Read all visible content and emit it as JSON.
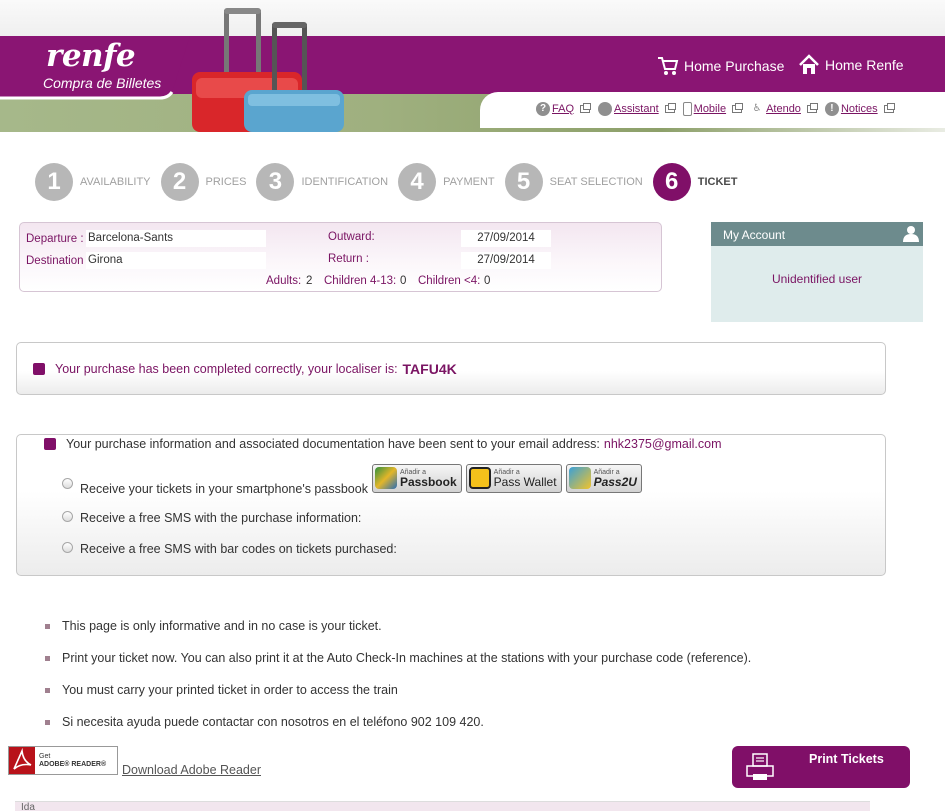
{
  "brand": {
    "logo": "renfe",
    "subtitle": "Compra de Billetes",
    "colors": {
      "primary": "#800f68",
      "account_header": "#6d8b8d",
      "account_bg": "#dfecec"
    }
  },
  "topnav": {
    "home_purchase": "Home Purchase",
    "home_renfe": "Home Renfe"
  },
  "utility": [
    {
      "icon": "help-icon",
      "label": "FAQ"
    },
    {
      "icon": "chat-icon",
      "label": "Assistant"
    },
    {
      "icon": "mobile-icon",
      "label": "Mobile"
    },
    {
      "icon": "accessibility-icon",
      "label": "Atendo"
    },
    {
      "icon": "alert-icon",
      "label": "Notices"
    }
  ],
  "steps": [
    {
      "num": "1",
      "label": "AVAILABILITY",
      "active": false
    },
    {
      "num": "2",
      "label": "PRICES",
      "active": false
    },
    {
      "num": "3",
      "label": "IDENTIFICATION",
      "active": false
    },
    {
      "num": "4",
      "label": "PAYMENT",
      "active": false
    },
    {
      "num": "5",
      "label": "SEAT SELECTION",
      "active": false
    },
    {
      "num": "6",
      "label": "TICKET",
      "active": true
    }
  ],
  "journey": {
    "departure_label": "Departure :",
    "departure": "Barcelona-Sants",
    "destination_label": "Destination",
    "destination": "Girona",
    "outward_label": "Outward:",
    "outward": "27/09/2014",
    "return_label": "Return :",
    "return": "27/09/2014",
    "adults_label": "Adults:",
    "adults": "2",
    "children_label": "Children 4-13:",
    "children": "0",
    "infants_label": "Children <4:",
    "infants": "0"
  },
  "account": {
    "title": "My Account",
    "user": "Unidentified user"
  },
  "confirmation": {
    "text": "Your purchase has been completed correctly, your localiser is:",
    "localiser": "TAFU4K"
  },
  "info": {
    "text": "Your purchase information and associated documentation have been sent to your email address:",
    "email": "nhk2375@gmail.com",
    "options": [
      "Receive your tickets in your smartphone's passbook",
      "Receive a free SMS with the purchase information:",
      "Receive a free SMS with bar codes on tickets purchased:"
    ],
    "badges": [
      {
        "small": "Añadir a",
        "big": "Passbook"
      },
      {
        "small": "Añadir a",
        "big": "Pass Wallet"
      },
      {
        "small": "Añadir a",
        "big": "Pass2U"
      }
    ]
  },
  "notes": [
    "This page is only informative and in no case is your ticket.",
    "Print your ticket now. You can also print it at the Auto Check-In machines at the stations with your purchase code (reference).",
    "You must carry your printed ticket in order to access the train",
    "Si necesita ayuda puede contactar con nosotros en el teléfono 902 109 420."
  ],
  "adobe": {
    "badge_small": "Get",
    "badge_big": "ADOBE® READER®",
    "download": "Download Adobe Reader"
  },
  "print_button": "Print Tickets",
  "ida": "Ida"
}
